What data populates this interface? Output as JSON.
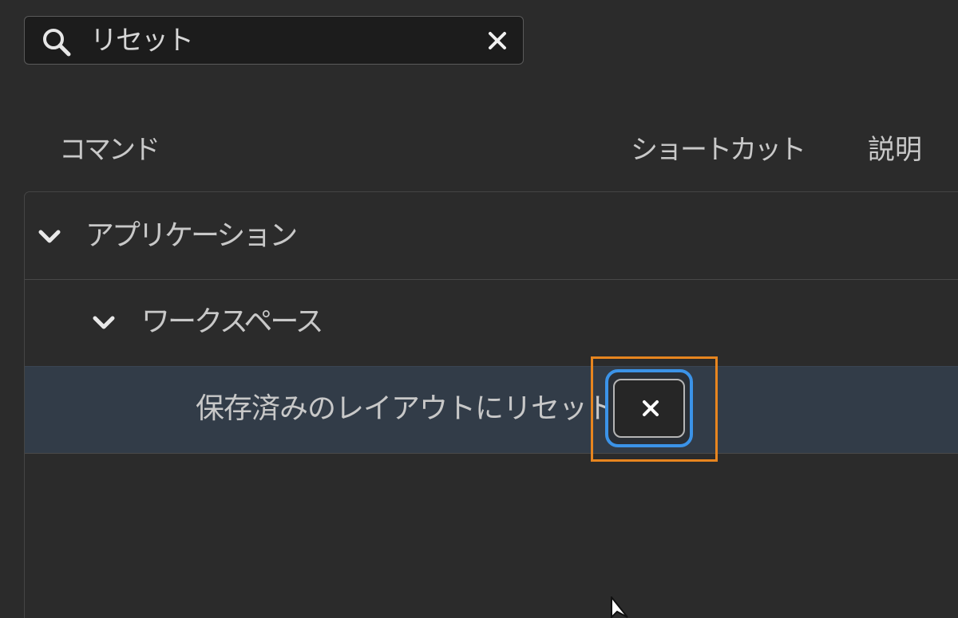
{
  "search": {
    "value": "リセット",
    "icon": "search-icon",
    "clear_icon": "close-icon"
  },
  "columns": {
    "command": "コマンド",
    "shortcut": "ショートカット",
    "description": "説明"
  },
  "tree": {
    "group": "アプリケーション",
    "subgroup": "ワークスペース",
    "item": {
      "label": "保存済みのレイアウトにリセット",
      "shortcut_value": "",
      "remove_icon": "close-icon"
    }
  },
  "colors": {
    "background": "#2b2b2b",
    "selected_row": "#323c48",
    "focus_ring": "#3b93e8",
    "highlight_frame": "#e7851f"
  }
}
